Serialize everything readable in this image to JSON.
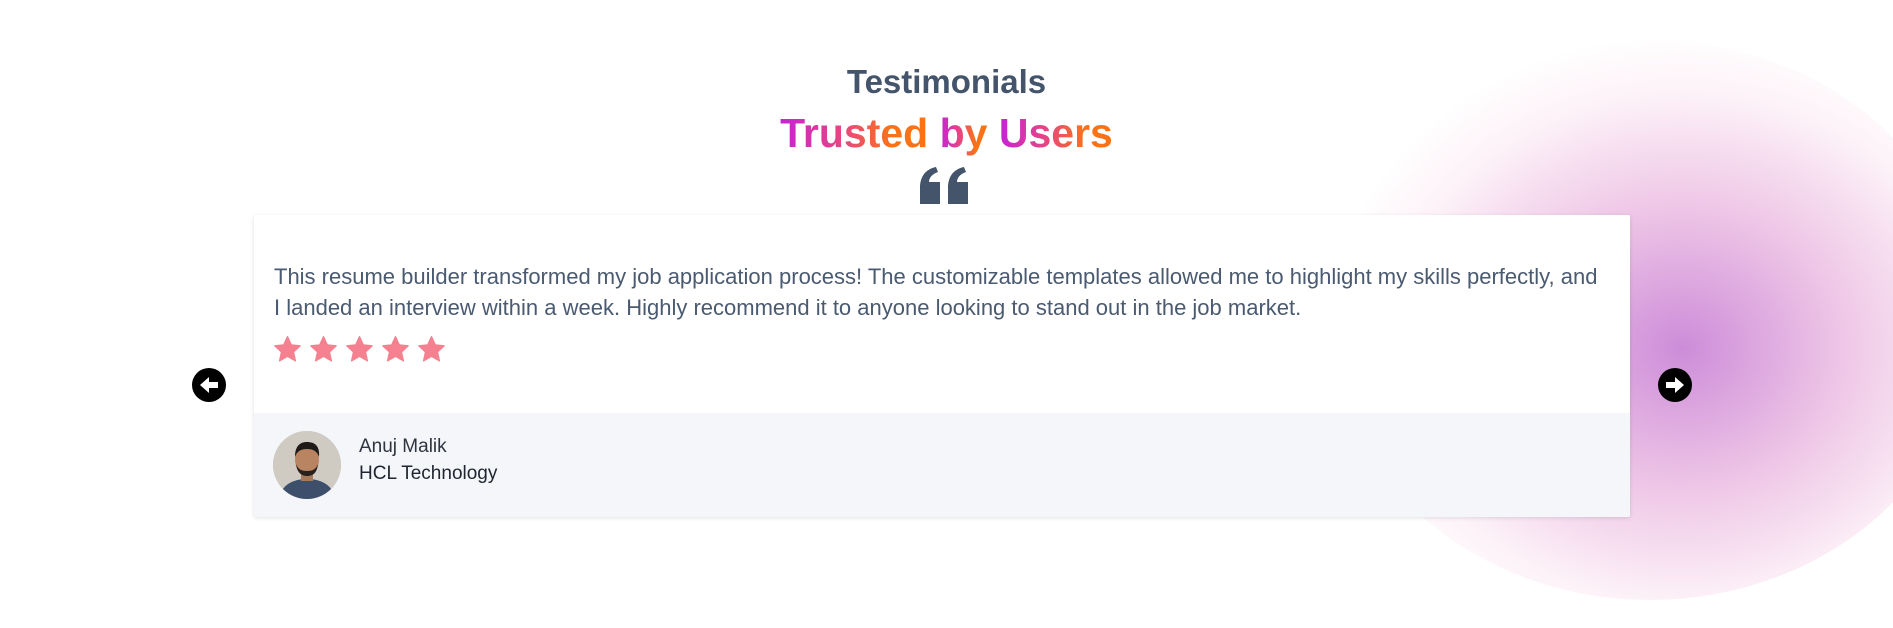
{
  "section": {
    "label": "Testimonials",
    "headline_part1": "Trusted",
    "headline_part2": "by",
    "headline_part3": "Users"
  },
  "testimonial": {
    "text": "This resume builder transformed my job application process! The customizable templates allowed me to highlight my skills perfectly, and I landed an interview within a week. Highly recommend it to anyone looking to stand out in the job market.",
    "rating": 5,
    "rating_max": 5,
    "author_name": "Anuj Malik",
    "author_company": "HCL Technology"
  },
  "icons": {
    "quote": "quote-open-icon",
    "star": "star-icon",
    "prev": "arrow-left-circle-icon",
    "next": "arrow-right-circle-icon"
  },
  "colors": {
    "heading": "#44546b",
    "gradient_start": "#c621d9",
    "gradient_mid": "#e9497a",
    "gradient_end": "#f97316",
    "star": "#f5808f",
    "body_text": "#4a5a70",
    "footer_bg": "#f4f6f9"
  }
}
